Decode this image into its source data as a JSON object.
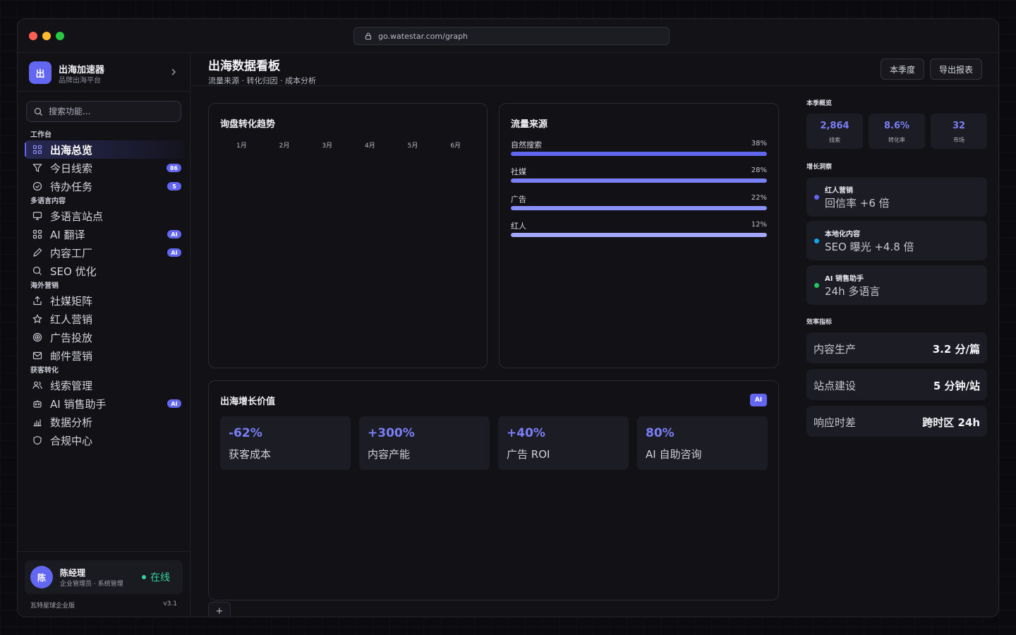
{
  "browser": {
    "url": "go.watestar.com/graph"
  },
  "brand": {
    "logo": "出",
    "name": "出海加速器",
    "subtitle": "品牌出海平台"
  },
  "search": {
    "placeholder": "搜索功能..."
  },
  "nav": {
    "sections": [
      {
        "title": "工作台",
        "items": [
          {
            "label": "出海总览",
            "icon": "grid-icon",
            "active": true,
            "badge": ""
          },
          {
            "label": "今日线索",
            "icon": "filter-icon",
            "badge": "86"
          },
          {
            "label": "待办任务",
            "icon": "check-circle-icon",
            "badge": "5"
          }
        ]
      },
      {
        "title": "多语言内容",
        "items": [
          {
            "label": "多语言站点",
            "icon": "monitor-icon",
            "badge": ""
          },
          {
            "label": "AI 翻译",
            "icon": "grid-icon",
            "badge": "AI"
          },
          {
            "label": "内容工厂",
            "icon": "pen-icon",
            "badge": "AI"
          },
          {
            "label": "SEO 优化",
            "icon": "search-icon",
            "badge": ""
          }
        ]
      },
      {
        "title": "海外营销",
        "items": [
          {
            "label": "社媒矩阵",
            "icon": "share-icon",
            "badge": ""
          },
          {
            "label": "红人营销",
            "icon": "star-icon",
            "badge": ""
          },
          {
            "label": "广告投放",
            "icon": "target-icon",
            "badge": ""
          },
          {
            "label": "邮件营销",
            "icon": "mail-icon",
            "badge": ""
          }
        ]
      },
      {
        "title": "获客转化",
        "items": [
          {
            "label": "线索管理",
            "icon": "users-icon",
            "badge": ""
          },
          {
            "label": "AI 销售助手",
            "icon": "bot-icon",
            "badge": "AI"
          },
          {
            "label": "数据分析",
            "icon": "bar-chart-icon",
            "badge": ""
          },
          {
            "label": "合规中心",
            "icon": "shield-icon",
            "badge": ""
          }
        ]
      }
    ]
  },
  "user": {
    "avatar": "陈",
    "name": "陈经理",
    "role": "企业管理员 · 系统管理",
    "status": "在线"
  },
  "footer": {
    "edition": "瓦特星球企业版",
    "version": "v3.1"
  },
  "header": {
    "title": "出海数据看板",
    "subtitle": "流量来源 · 转化归因 · 成本分析",
    "btn_quarter": "本季度",
    "btn_export": "导出报表"
  },
  "trend": {
    "title": "询盘转化趋势",
    "months": [
      "1月",
      "2月",
      "3月",
      "4月",
      "5月",
      "6月"
    ]
  },
  "traffic": {
    "title": "流量来源",
    "rows": [
      {
        "label": "自然搜索",
        "pct": "38%",
        "value": 38,
        "color": "#6366f1"
      },
      {
        "label": "社媒",
        "pct": "28%",
        "value": 28,
        "color": "#7b7ff7"
      },
      {
        "label": "广告",
        "pct": "22%",
        "value": 22,
        "color": "#8b8ff8"
      },
      {
        "label": "红人",
        "pct": "12%",
        "value": 12,
        "color": "#a5a8fa"
      }
    ]
  },
  "growth": {
    "title": "出海增长价值",
    "tag": "AI",
    "stats": [
      {
        "value": "-62%",
        "label": "获客成本"
      },
      {
        "value": "+300%",
        "label": "内容产能"
      },
      {
        "value": "+40%",
        "label": "广告 ROI"
      },
      {
        "value": "80%",
        "label": "AI 自助咨询"
      }
    ],
    "add": "+"
  },
  "overview": {
    "title": "本季概览",
    "kpis": [
      {
        "value": "2,864",
        "label": "线索"
      },
      {
        "value": "8.6%",
        "label": "转化率"
      },
      {
        "value": "32",
        "label": "市场"
      }
    ]
  },
  "insights": {
    "title": "增长洞察",
    "items": [
      {
        "title": "红人营销",
        "desc": "回信率 +6 倍",
        "color": "#6366f1"
      },
      {
        "title": "本地化内容",
        "desc": "SEO 曝光 +4.8 倍",
        "color": "#0ea5e9"
      },
      {
        "title": "AI 销售助手",
        "desc": "24h 多语言",
        "color": "#22c55e"
      }
    ]
  },
  "efficiency": {
    "title": "效率指标",
    "items": [
      {
        "label": "内容生产",
        "value": "3.2 分/篇"
      },
      {
        "label": "站点建设",
        "value": "5 分钟/站"
      },
      {
        "label": "响应时差",
        "value": "跨时区 24h"
      }
    ]
  }
}
